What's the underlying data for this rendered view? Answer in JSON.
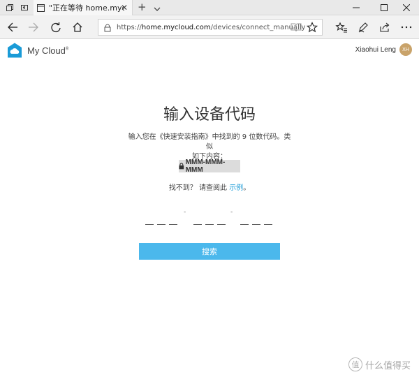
{
  "browser": {
    "tab_title": "\"正在等待 home.myclou",
    "url_scheme": "https://",
    "url_host": "home.mycloud.com",
    "url_path": "/devices/connect_manually"
  },
  "header": {
    "logo": "My Cloud",
    "logo_mark": "®",
    "user_name": "Xiaohui Leng",
    "avatar_initials": "XH"
  },
  "main": {
    "title": "输入设备代码",
    "instruction_line1": "输入您在《快速安装指南》中找到的 9 位数代码。类似",
    "instruction_line2": "如下内容：",
    "code_example": "MMM-MMM-MMM",
    "help_prefix": "找不到？ 请查阅此",
    "help_link": "示例",
    "help_suffix": "。",
    "separator": "-",
    "submit_label": "搜索"
  },
  "watermark": {
    "text": "什么值得买",
    "icon_glyph": "值"
  },
  "colors": {
    "accent": "#4bb8ec",
    "link": "#1a9bd7",
    "logo": "#1a9bd7",
    "avatar": "#c9a36a"
  }
}
